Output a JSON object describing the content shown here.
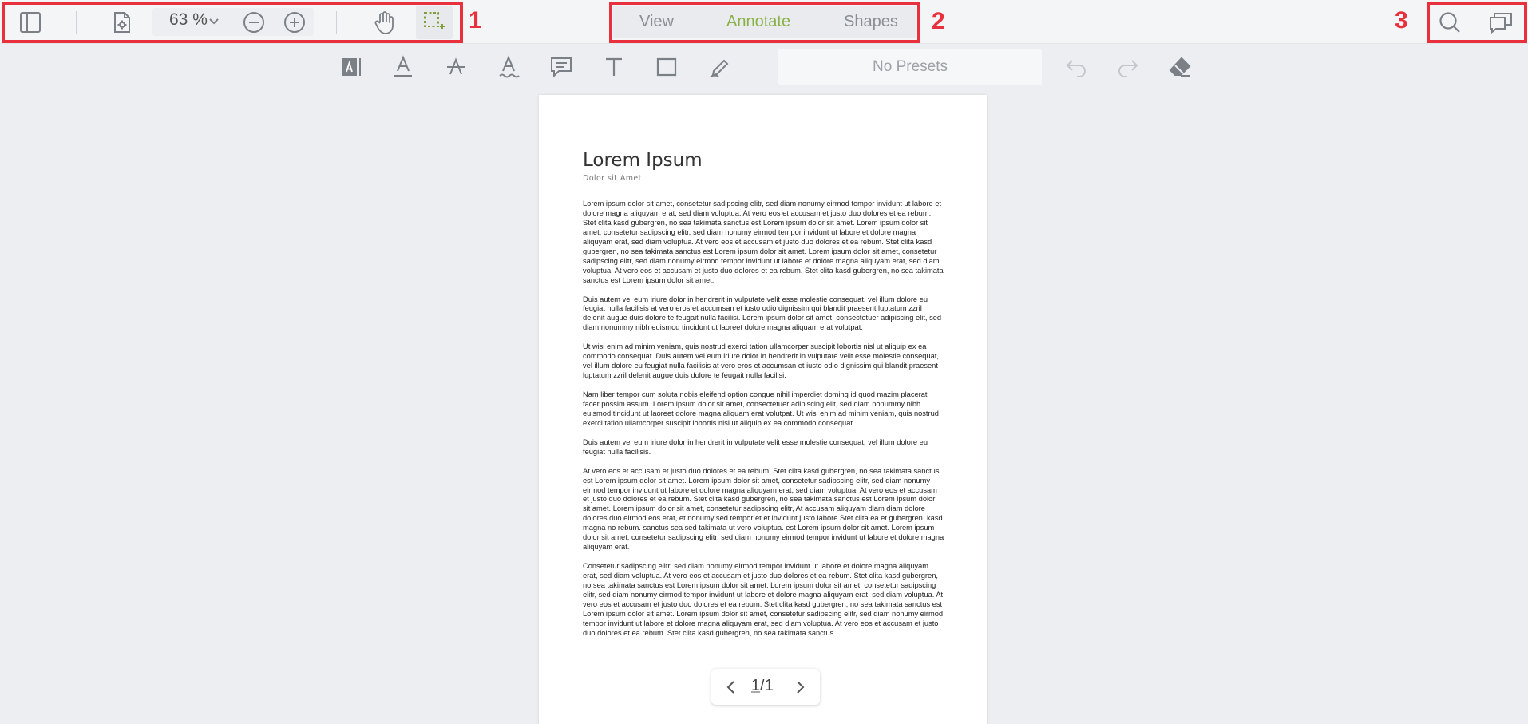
{
  "toolbar": {
    "zoom": "63 %"
  },
  "tabs": [
    {
      "label": "View"
    },
    {
      "label": "Annotate"
    },
    {
      "label": "Shapes"
    }
  ],
  "annotate_toolbar": {
    "presets": "No Presets"
  },
  "callouts": [
    "1",
    "2",
    "3"
  ],
  "document": {
    "title": "Lorem Ipsum",
    "subtitle": "Dolor sit Amet",
    "paragraphs": [
      "Lorem ipsum dolor sit amet, consetetur sadipscing elitr, sed diam nonumy eirmod tempor invidunt ut labore et dolore magna aliquyam erat, sed diam voluptua. At vero eos et accusam et justo duo dolores et ea rebum. Stet clita kasd gubergren, no sea takimata sanctus est Lorem ipsum dolor sit amet. Lorem ipsum dolor sit amet, consetetur sadipscing elitr, sed diam nonumy eirmod tempor invidunt ut labore et dolore magna aliquyam erat, sed diam voluptua. At vero eos et accusam et justo duo dolores et ea rebum. Stet clita kasd gubergren, no sea takimata sanctus est Lorem ipsum dolor sit amet. Lorem ipsum dolor sit amet, consetetur sadipscing elitr, sed diam nonumy eirmod tempor invidunt ut labore et dolore magna aliquyam erat, sed diam voluptua. At vero eos et accusam et justo duo dolores et ea rebum. Stet clita kasd gubergren, no sea takimata sanctus est Lorem ipsum dolor sit amet.",
      "Duis autem vel eum iriure dolor in hendrerit in vulputate velit esse molestie consequat, vel illum dolore eu feugiat nulla facilisis at vero eros et accumsan et iusto odio dignissim qui blandit praesent luptatum zzril delenit augue duis dolore te feugait nulla facilisi. Lorem ipsum dolor sit amet, consectetuer adipiscing elit, sed diam nonummy nibh euismod tincidunt ut laoreet dolore magna aliquam erat volutpat.",
      "Ut wisi enim ad minim veniam, quis nostrud exerci tation ullamcorper suscipit lobortis nisl ut aliquip ex ea commodo consequat. Duis autem vel eum iriure dolor in hendrerit in vulputate velit esse molestie consequat, vel illum dolore eu feugiat nulla facilisis at vero eros et accumsan et iusto odio dignissim qui blandit praesent luptatum zzril delenit augue duis dolore te feugait nulla facilisi.",
      "Nam liber tempor cum soluta nobis eleifend option congue nihil imperdiet doming id quod mazim placerat facer possim assum. Lorem ipsum dolor sit amet, consectetuer adipiscing elit, sed diam nonummy nibh euismod tincidunt ut laoreet dolore magna aliquam erat volutpat. Ut wisi enim ad minim veniam, quis nostrud exerci tation ullamcorper suscipit lobortis nisl ut aliquip ex ea commodo consequat.",
      "Duis autem vel eum iriure dolor in hendrerit in vulputate velit esse molestie consequat, vel illum dolore eu feugiat nulla facilisis.",
      "At vero eos et accusam et justo duo dolores et ea rebum. Stet clita kasd gubergren, no sea takimata sanctus est Lorem ipsum dolor sit amet. Lorem ipsum dolor sit amet, consetetur sadipscing elitr, sed diam nonumy eirmod tempor invidunt ut labore et dolore magna aliquyam erat, sed diam voluptua. At vero eos et accusam et justo duo dolores et ea rebum. Stet clita kasd gubergren, no sea takimata sanctus est Lorem ipsum dolor sit amet. Lorem ipsum dolor sit amet, consetetur sadipscing elitr, At accusam aliquyam diam diam dolore dolores duo eirmod eos erat, et nonumy sed tempor et et invidunt justo labore Stet clita ea et gubergren, kasd magna no rebum. sanctus sea sed takimata ut vero voluptua. est Lorem ipsum dolor sit amet. Lorem ipsum dolor sit amet, consetetur sadipscing elitr, sed diam nonumy eirmod tempor invidunt ut labore et dolore magna aliquyam erat.",
      "Consetetur sadipscing elitr, sed diam nonumy eirmod tempor invidunt ut labore et dolore magna aliquyam erat, sed diam voluptua. At vero eos et accusam et justo duo dolores et ea rebum. Stet clita kasd gubergren, no sea takimata sanctus est Lorem ipsum dolor sit amet. Lorem ipsum dolor sit amet, consetetur sadipscing elitr, sed diam nonumy eirmod tempor invidunt ut labore et dolore magna aliquyam erat, sed diam voluptua. At vero eos et accusam et justo duo dolores et ea rebum. Stet clita kasd gubergren, no sea takimata sanctus est Lorem ipsum dolor sit amet. Lorem ipsum dolor sit amet, consetetur sadipscing elitr, sed diam nonumy eirmod tempor invidunt ut labore et dolore magna aliquyam erat, sed diam voluptua. At vero eos et accusam et justo duo dolores et ea rebum. Stet clita kasd gubergren, no sea takimata sanctus."
    ]
  },
  "pager": {
    "current": "1",
    "separator": "/",
    "total": "1"
  },
  "colors": {
    "accent": "#8ab146",
    "callout": "#e8313d"
  }
}
